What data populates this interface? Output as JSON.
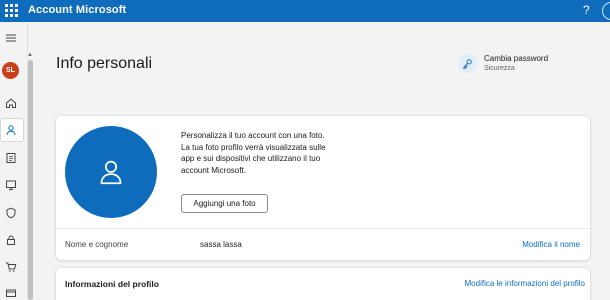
{
  "header": {
    "app_title": "Account Microsoft",
    "help_label": "?",
    "brand_color": "#0f6cbd"
  },
  "sidebar": {
    "avatar_initials": "SL",
    "avatar_color": "#c9401c",
    "items": [
      {
        "icon": "menu-icon"
      },
      {
        "icon": "home-icon"
      },
      {
        "icon": "person-icon",
        "selected": true
      },
      {
        "icon": "document-icon"
      },
      {
        "icon": "monitor-icon"
      },
      {
        "icon": "shield-icon"
      },
      {
        "icon": "lock-icon"
      },
      {
        "icon": "cart-icon"
      },
      {
        "icon": "card-icon"
      }
    ]
  },
  "page": {
    "title": "Info personali",
    "password_link": {
      "title": "Cambia password",
      "subtitle": "Sicurezza",
      "icon": "key-icon"
    }
  },
  "photo_card": {
    "description": "Personalizza il tuo account con una foto. La tua foto profilo verrà visualizzata sulle app e sui dispositivi che utilizzano il tuo account Microsoft.",
    "add_photo_label": "Aggiungi una foto",
    "name_label": "Nome e cognome",
    "name_value": "sassa lassa",
    "edit_name_label": "Modifica il nome"
  },
  "profile_card": {
    "title": "Informazioni del profilo",
    "edit_label": "Modifica le informazioni del profilo"
  }
}
